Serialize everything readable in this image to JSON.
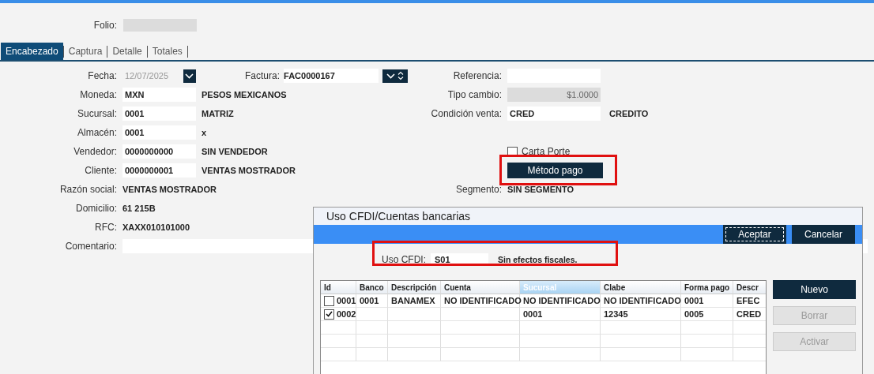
{
  "folio": {
    "label": "Folio:"
  },
  "tabs": [
    {
      "label": "Encabezado",
      "selected": true
    },
    {
      "label": "Captura",
      "selected": false
    },
    {
      "label": "Detalle",
      "selected": false
    },
    {
      "label": "Totales",
      "selected": false
    }
  ],
  "rows": [
    {
      "left": {
        "kind": "date",
        "label": "Fecha:",
        "value": "12/07/2025",
        "disabled": true
      },
      "middle": {
        "label": "Factura:",
        "value": "FAC0000167"
      },
      "right": {
        "kind": "field",
        "label": "Referencia:"
      }
    },
    {
      "left": {
        "kind": "field",
        "label": "Moneda:",
        "value": "MXN",
        "description": "PESOS MEXICANOS"
      },
      "right": {
        "kind": "field",
        "label": "Tipo cambio:",
        "value": "$1.0000",
        "disabled": true
      }
    },
    {
      "left": {
        "kind": "field",
        "label": "Sucursal:",
        "value": "0001",
        "description": "MATRIZ"
      },
      "right": {
        "kind": "field",
        "label": "Condición venta:",
        "value": "CRED",
        "description": "CREDITO"
      }
    },
    {
      "left": {
        "kind": "field",
        "label": "Almacén:",
        "value": "0001",
        "description": "x"
      }
    },
    {
      "left": {
        "kind": "field",
        "label": "Vendedor:",
        "value": "0000000000",
        "description": "SIN VENDEDOR"
      },
      "right": {
        "kind": "checkbox",
        "label": "Carta Porte",
        "checked": false
      }
    },
    {
      "left": {
        "kind": "field",
        "label": "Cliente:",
        "value": "0000000001",
        "description": "VENTAS MOSTRADOR"
      },
      "right": {
        "kind": "button",
        "label": "Método pago",
        "highlighted": true
      }
    },
    {
      "left": {
        "kind": "text",
        "label": "Razón social:",
        "value": "VENTAS MOSTRADOR"
      },
      "right": {
        "kind": "text",
        "label": "Segmento:",
        "value": "SIN SEGMENTO"
      }
    },
    {
      "left": {
        "kind": "text",
        "label": "Domicilio:",
        "value": "61 215B"
      }
    },
    {
      "left": {
        "kind": "text",
        "label": "RFC:",
        "value": "XAXX010101000"
      }
    },
    {
      "left": {
        "kind": "wide",
        "label": "Comentario:"
      }
    }
  ],
  "dialog": {
    "title": "Uso CFDI/Cuentas bancarias",
    "buttons": [
      {
        "label": "Aceptar",
        "kind": "default"
      },
      {
        "label": "Cancelar",
        "kind": "normal"
      }
    ],
    "uso_cfdi": {
      "label": "Uso CFDI:",
      "value": "S01",
      "description": "Sin efectos fiscales.",
      "highlighted": true
    },
    "table": {
      "columns": [
        {
          "label": "Id",
          "selected": false
        },
        {
          "label": "Banco",
          "selected": false
        },
        {
          "label": "Descripción",
          "selected": false
        },
        {
          "label": "Cuenta",
          "selected": false
        },
        {
          "label": "Sucursal",
          "selected": true
        },
        {
          "label": "Clabe",
          "selected": false
        },
        {
          "label": "Forma pago",
          "selected": false
        },
        {
          "label": "Descr",
          "selected": false
        }
      ],
      "rows": [
        {
          "checked": false,
          "cells": [
            "0001",
            "0001",
            "BANAMEX",
            "NO IDENTIFICADO",
            "NO IDENTIFICADO",
            "NO IDENTIFICADO",
            "0001",
            "EFEC"
          ]
        },
        {
          "checked": true,
          "cells": [
            "0002",
            null,
            null,
            null,
            "0001",
            "12345",
            "0005",
            "CRED"
          ]
        }
      ]
    },
    "side_buttons": [
      {
        "label": "Nuevo",
        "disabled": false
      },
      {
        "label": "Borrar",
        "disabled": true
      },
      {
        "label": "Activar",
        "disabled": true
      }
    ]
  }
}
